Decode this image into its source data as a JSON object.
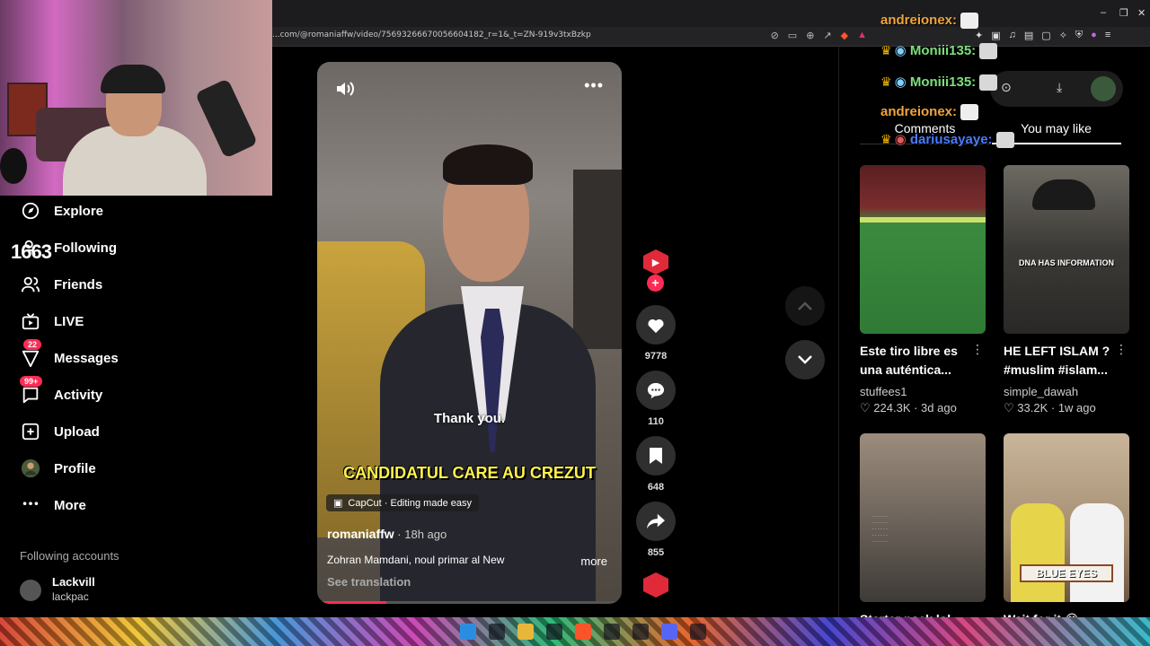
{
  "browser": {
    "url": "...com/@romaniaffw/video/75693266670056604182_r=1&_t=ZN-919v3txBzkp",
    "window_controls": [
      "–",
      "❐",
      "✕"
    ]
  },
  "sidebar": {
    "stream_overlay": "1663",
    "items": [
      {
        "label": "Explore",
        "icon": "compass-icon"
      },
      {
        "label": "Following",
        "icon": "following-icon"
      },
      {
        "label": "Friends",
        "icon": "friends-icon"
      },
      {
        "label": "LIVE",
        "icon": "live-icon"
      },
      {
        "label": "Messages",
        "icon": "messages-icon",
        "badge": "22"
      },
      {
        "label": "Activity",
        "icon": "activity-icon",
        "badge": "99+"
      },
      {
        "label": "Upload",
        "icon": "upload-icon"
      },
      {
        "label": "Profile",
        "icon": "profile-icon"
      },
      {
        "label": "More",
        "icon": "more-icon"
      }
    ],
    "following_header": "Following accounts",
    "accounts": [
      {
        "name": "Lackvill",
        "handle": "lackpac"
      }
    ]
  },
  "video": {
    "caption_small": "Thank you.",
    "caption_big": "CANDIDATUL CARE AU CREZUT",
    "capcut_label": "CapCut · Editing made easy",
    "author": "romaniaffw",
    "time_ago": " · 18h ago",
    "description": "Zohran Mamdani, noul primar al New",
    "more_label": "more",
    "see_translation": "See translation",
    "progress_percent": 22
  },
  "actions": {
    "likes": "9778",
    "comments": "110",
    "saves": "648",
    "shares": "855"
  },
  "chat": [
    {
      "user": "andreionex:",
      "color": "#f0a43b",
      "crown": false
    },
    {
      "user": "Moniii135:",
      "color": "#7be07b",
      "crown": true
    },
    {
      "user": "Moniii135:",
      "color": "#7be07b",
      "crown": true
    },
    {
      "user": "andreionex:",
      "color": "#f0a43b",
      "crown": false
    },
    {
      "user": "dariusayaye:",
      "color": "#4a7bff",
      "crown": true
    }
  ],
  "tabs": {
    "comments": "Comments",
    "you_may_like": "You may like"
  },
  "recommendations": [
    {
      "title": "Este tiro libre es una auténtica...",
      "author": "stuffees1",
      "likes": "224.3K",
      "age": "3d ago",
      "thumb_text": ""
    },
    {
      "title": "HE LEFT ISLAM ? #muslim #islam...",
      "author": "simple_dawah",
      "likes": "33.2K",
      "age": "1w ago",
      "thumb_text": "DNA HAS INFORMATION"
    },
    {
      "title": "Starter pack lol",
      "author": "",
      "likes": "",
      "age": "",
      "thumb_text": ""
    },
    {
      "title": "Wait for it 😂",
      "author": "",
      "likes": "",
      "age": "",
      "thumb_text": "BLUE EYES"
    }
  ],
  "colors": {
    "accent": "#fe2c55",
    "background": "#000000",
    "caption_yellow": "#fff34d"
  }
}
